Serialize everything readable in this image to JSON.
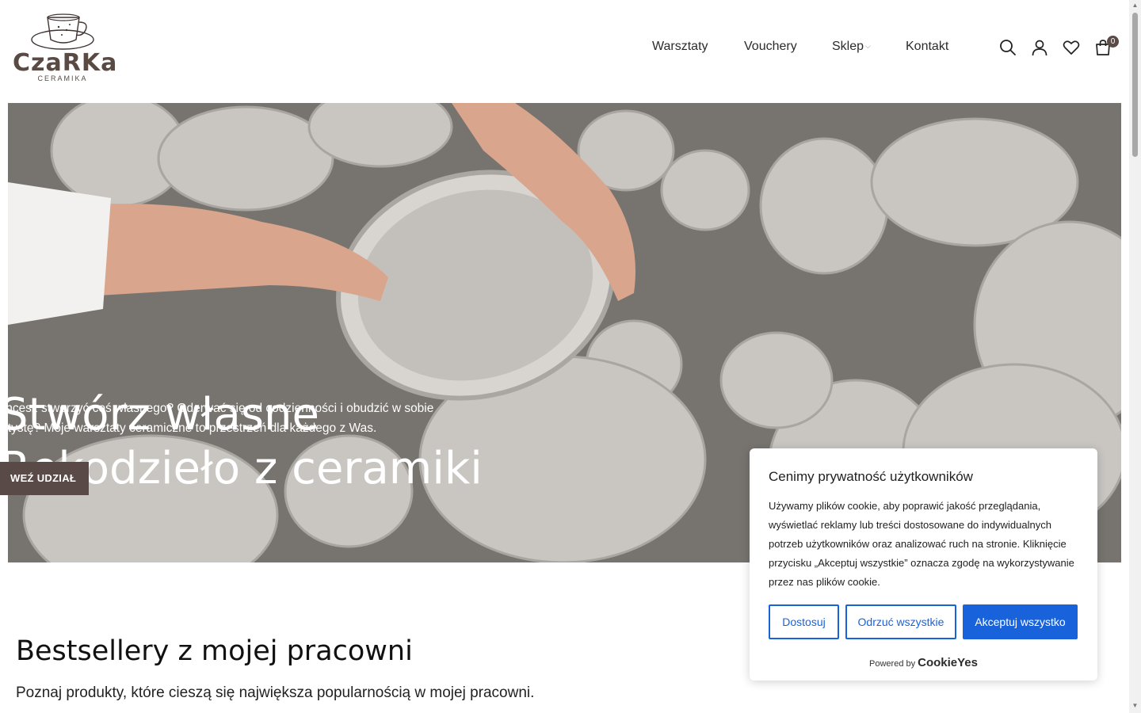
{
  "brand": {
    "name": "CzaRKa",
    "tagline": "CERAMIKA"
  },
  "nav": {
    "items": [
      "Warsztaty",
      "Vouchery",
      "Sklep",
      "Kontakt"
    ]
  },
  "header_icons": {
    "search": "search-icon",
    "account": "user-icon",
    "wishlist": "heart-icon",
    "cart": "cart-icon",
    "cart_count": "0"
  },
  "hero": {
    "title_line1": "Stwórz własne",
    "title_line2": "Rękodzieło z ceramiki",
    "desc_line1": "Chcesz stworzyć coś własnego? Oderwać się od codzienności i obudzić w sobie",
    "desc_line2": "artystę? Moje warsztaty ceramiczne to przestrzeń dla każdego z Was.",
    "cta": "WEŹ UDZIAŁ"
  },
  "bestsellers": {
    "title": "Bestsellery z mojej pracowni",
    "subtitle": "Poznaj produkty, które cieszą się największa popularnością w mojej pracowni."
  },
  "cookie": {
    "title": "Cenimy prywatność użytkowników",
    "text": "Używamy plików cookie, aby poprawić jakość przeglądania, wyświetlać reklamy lub treści dostosowane do indywidualnych potrzeb użytkowników oraz analizować ruch na stronie. Kliknięcie przycisku „Akceptuj wszystkie” oznacza zgodę na wykorzystywanie przez nas plików cookie.",
    "customize": "Dostosuj",
    "reject": "Odrzuć wszystkie",
    "accept": "Akceptuj wszystko",
    "powered_by": "Powered by",
    "powered_brand": "CookieYes"
  },
  "colors": {
    "brand": "#5a4a47",
    "cookie_accent": "#1863dc"
  }
}
